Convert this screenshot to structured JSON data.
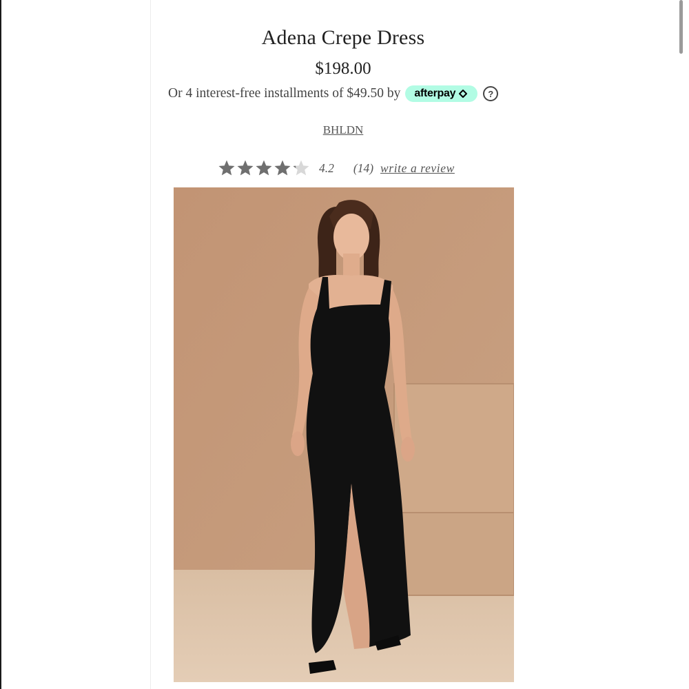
{
  "product": {
    "title": "Adena Crepe Dress",
    "price": "$198.00",
    "brand": "BHLDN"
  },
  "payment": {
    "installments_text": "Or 4 interest-free installments of $49.50 by",
    "provider_label": "afterpay",
    "provider_color": "#b2fce4",
    "help_glyph": "?"
  },
  "rating": {
    "value": 4.2,
    "value_text": "4.2",
    "max_stars": 5,
    "review_count_text": "(14)",
    "write_review_label": "write a review",
    "star_color": "#6f6f6f",
    "star_empty_color": "#d8d8d8"
  },
  "image": {
    "subject": "model-in-black-crepe-gown",
    "backdrop_color": "#c49a79",
    "dress_color": "#111111"
  },
  "icons": [
    "star-icon",
    "afterpay-arrows-icon",
    "help-icon"
  ]
}
